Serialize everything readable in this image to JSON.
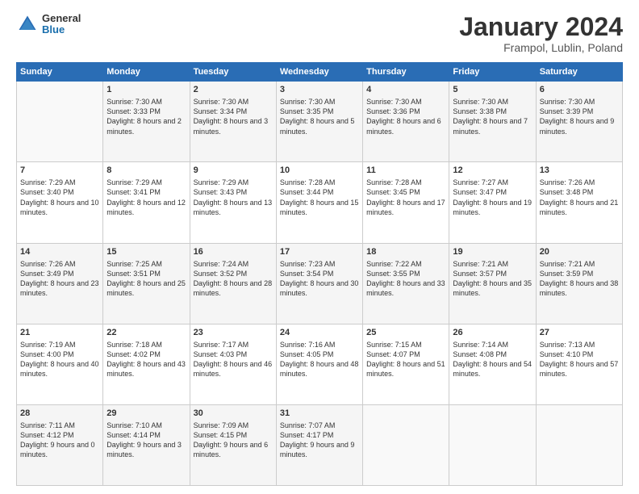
{
  "logo": {
    "general": "General",
    "blue": "Blue"
  },
  "header": {
    "month": "January 2024",
    "location": "Frampol, Lublin, Poland"
  },
  "weekdays": [
    "Sunday",
    "Monday",
    "Tuesday",
    "Wednesday",
    "Thursday",
    "Friday",
    "Saturday"
  ],
  "weeks": [
    [
      {
        "day": "",
        "sunrise": "",
        "sunset": "",
        "daylight": ""
      },
      {
        "day": "1",
        "sunrise": "Sunrise: 7:30 AM",
        "sunset": "Sunset: 3:33 PM",
        "daylight": "Daylight: 8 hours and 2 minutes."
      },
      {
        "day": "2",
        "sunrise": "Sunrise: 7:30 AM",
        "sunset": "Sunset: 3:34 PM",
        "daylight": "Daylight: 8 hours and 3 minutes."
      },
      {
        "day": "3",
        "sunrise": "Sunrise: 7:30 AM",
        "sunset": "Sunset: 3:35 PM",
        "daylight": "Daylight: 8 hours and 5 minutes."
      },
      {
        "day": "4",
        "sunrise": "Sunrise: 7:30 AM",
        "sunset": "Sunset: 3:36 PM",
        "daylight": "Daylight: 8 hours and 6 minutes."
      },
      {
        "day": "5",
        "sunrise": "Sunrise: 7:30 AM",
        "sunset": "Sunset: 3:38 PM",
        "daylight": "Daylight: 8 hours and 7 minutes."
      },
      {
        "day": "6",
        "sunrise": "Sunrise: 7:30 AM",
        "sunset": "Sunset: 3:39 PM",
        "daylight": "Daylight: 8 hours and 9 minutes."
      }
    ],
    [
      {
        "day": "7",
        "sunrise": "Sunrise: 7:29 AM",
        "sunset": "Sunset: 3:40 PM",
        "daylight": "Daylight: 8 hours and 10 minutes."
      },
      {
        "day": "8",
        "sunrise": "Sunrise: 7:29 AM",
        "sunset": "Sunset: 3:41 PM",
        "daylight": "Daylight: 8 hours and 12 minutes."
      },
      {
        "day": "9",
        "sunrise": "Sunrise: 7:29 AM",
        "sunset": "Sunset: 3:43 PM",
        "daylight": "Daylight: 8 hours and 13 minutes."
      },
      {
        "day": "10",
        "sunrise": "Sunrise: 7:28 AM",
        "sunset": "Sunset: 3:44 PM",
        "daylight": "Daylight: 8 hours and 15 minutes."
      },
      {
        "day": "11",
        "sunrise": "Sunrise: 7:28 AM",
        "sunset": "Sunset: 3:45 PM",
        "daylight": "Daylight: 8 hours and 17 minutes."
      },
      {
        "day": "12",
        "sunrise": "Sunrise: 7:27 AM",
        "sunset": "Sunset: 3:47 PM",
        "daylight": "Daylight: 8 hours and 19 minutes."
      },
      {
        "day": "13",
        "sunrise": "Sunrise: 7:26 AM",
        "sunset": "Sunset: 3:48 PM",
        "daylight": "Daylight: 8 hours and 21 minutes."
      }
    ],
    [
      {
        "day": "14",
        "sunrise": "Sunrise: 7:26 AM",
        "sunset": "Sunset: 3:49 PM",
        "daylight": "Daylight: 8 hours and 23 minutes."
      },
      {
        "day": "15",
        "sunrise": "Sunrise: 7:25 AM",
        "sunset": "Sunset: 3:51 PM",
        "daylight": "Daylight: 8 hours and 25 minutes."
      },
      {
        "day": "16",
        "sunrise": "Sunrise: 7:24 AM",
        "sunset": "Sunset: 3:52 PM",
        "daylight": "Daylight: 8 hours and 28 minutes."
      },
      {
        "day": "17",
        "sunrise": "Sunrise: 7:23 AM",
        "sunset": "Sunset: 3:54 PM",
        "daylight": "Daylight: 8 hours and 30 minutes."
      },
      {
        "day": "18",
        "sunrise": "Sunrise: 7:22 AM",
        "sunset": "Sunset: 3:55 PM",
        "daylight": "Daylight: 8 hours and 33 minutes."
      },
      {
        "day": "19",
        "sunrise": "Sunrise: 7:21 AM",
        "sunset": "Sunset: 3:57 PM",
        "daylight": "Daylight: 8 hours and 35 minutes."
      },
      {
        "day": "20",
        "sunrise": "Sunrise: 7:21 AM",
        "sunset": "Sunset: 3:59 PM",
        "daylight": "Daylight: 8 hours and 38 minutes."
      }
    ],
    [
      {
        "day": "21",
        "sunrise": "Sunrise: 7:19 AM",
        "sunset": "Sunset: 4:00 PM",
        "daylight": "Daylight: 8 hours and 40 minutes."
      },
      {
        "day": "22",
        "sunrise": "Sunrise: 7:18 AM",
        "sunset": "Sunset: 4:02 PM",
        "daylight": "Daylight: 8 hours and 43 minutes."
      },
      {
        "day": "23",
        "sunrise": "Sunrise: 7:17 AM",
        "sunset": "Sunset: 4:03 PM",
        "daylight": "Daylight: 8 hours and 46 minutes."
      },
      {
        "day": "24",
        "sunrise": "Sunrise: 7:16 AM",
        "sunset": "Sunset: 4:05 PM",
        "daylight": "Daylight: 8 hours and 48 minutes."
      },
      {
        "day": "25",
        "sunrise": "Sunrise: 7:15 AM",
        "sunset": "Sunset: 4:07 PM",
        "daylight": "Daylight: 8 hours and 51 minutes."
      },
      {
        "day": "26",
        "sunrise": "Sunrise: 7:14 AM",
        "sunset": "Sunset: 4:08 PM",
        "daylight": "Daylight: 8 hours and 54 minutes."
      },
      {
        "day": "27",
        "sunrise": "Sunrise: 7:13 AM",
        "sunset": "Sunset: 4:10 PM",
        "daylight": "Daylight: 8 hours and 57 minutes."
      }
    ],
    [
      {
        "day": "28",
        "sunrise": "Sunrise: 7:11 AM",
        "sunset": "Sunset: 4:12 PM",
        "daylight": "Daylight: 9 hours and 0 minutes."
      },
      {
        "day": "29",
        "sunrise": "Sunrise: 7:10 AM",
        "sunset": "Sunset: 4:14 PM",
        "daylight": "Daylight: 9 hours and 3 minutes."
      },
      {
        "day": "30",
        "sunrise": "Sunrise: 7:09 AM",
        "sunset": "Sunset: 4:15 PM",
        "daylight": "Daylight: 9 hours and 6 minutes."
      },
      {
        "day": "31",
        "sunrise": "Sunrise: 7:07 AM",
        "sunset": "Sunset: 4:17 PM",
        "daylight": "Daylight: 9 hours and 9 minutes."
      },
      {
        "day": "",
        "sunrise": "",
        "sunset": "",
        "daylight": ""
      },
      {
        "day": "",
        "sunrise": "",
        "sunset": "",
        "daylight": ""
      },
      {
        "day": "",
        "sunrise": "",
        "sunset": "",
        "daylight": ""
      }
    ]
  ]
}
